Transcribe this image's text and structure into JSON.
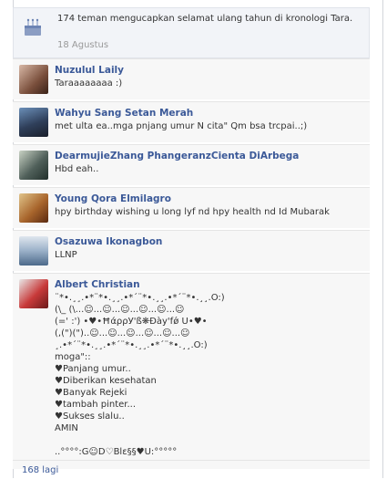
{
  "header": {
    "text": "174 teman mengucapkan selamat ulang tahun di kronologi Tara.",
    "date": "18 Agustus"
  },
  "posts": [
    {
      "name": "Nuzulul Laily",
      "message": "Taraaaaaaaa :)"
    },
    {
      "name": "Wahyu Sang Setan Merah",
      "message": "met ulta ea..mga pnjang umur N cita\" Qm bsa trcpai..;)"
    },
    {
      "name": "DearmujieZhang PhangeranzCienta DiArbega",
      "message": "Hbd eah.."
    },
    {
      "name": "Young Qora Elmilagro",
      "message": "hpy birthday wishing u long lyf nd hpy health nd Id Mubarak"
    },
    {
      "name": "Osazuwa Ikonagbon",
      "message": "LLNP"
    },
    {
      "name": "Albert Christian",
      "lines": [
        "¨*•.¸¸.•*¨*•.¸¸.•*´¨*•.¸¸.•*´¨*•.¸¸.O:)",
        "(\\_ (\\...☺...☺...☺...☺...☺...☺",
        "(=' :') •♥•ĦάρρУ'ß❋Đàу'fǿ U•♥•",
        "(,(\")(\")..☺...☺...☺...☺...☺...☺",
        "¸.•*´¨*•.¸¸.•*´¨*•.¸¸.•*´¨*•.¸¸.O:)",
        "moga\"::",
        "♥Panjang umur..",
        "♥Diberikan kesehatan",
        "♥Banyak Rejeki",
        "♥tambah pinter...",
        "♥Sukses slalu..",
        "AMIN",
        "",
        "..°°°°:G☺D♡Blε§§♥U:°°°°°"
      ]
    }
  ],
  "footer": {
    "more_label": "168 lagi"
  },
  "colors": {
    "link": "#3b5998",
    "text": "#333333",
    "muted": "#999999"
  }
}
